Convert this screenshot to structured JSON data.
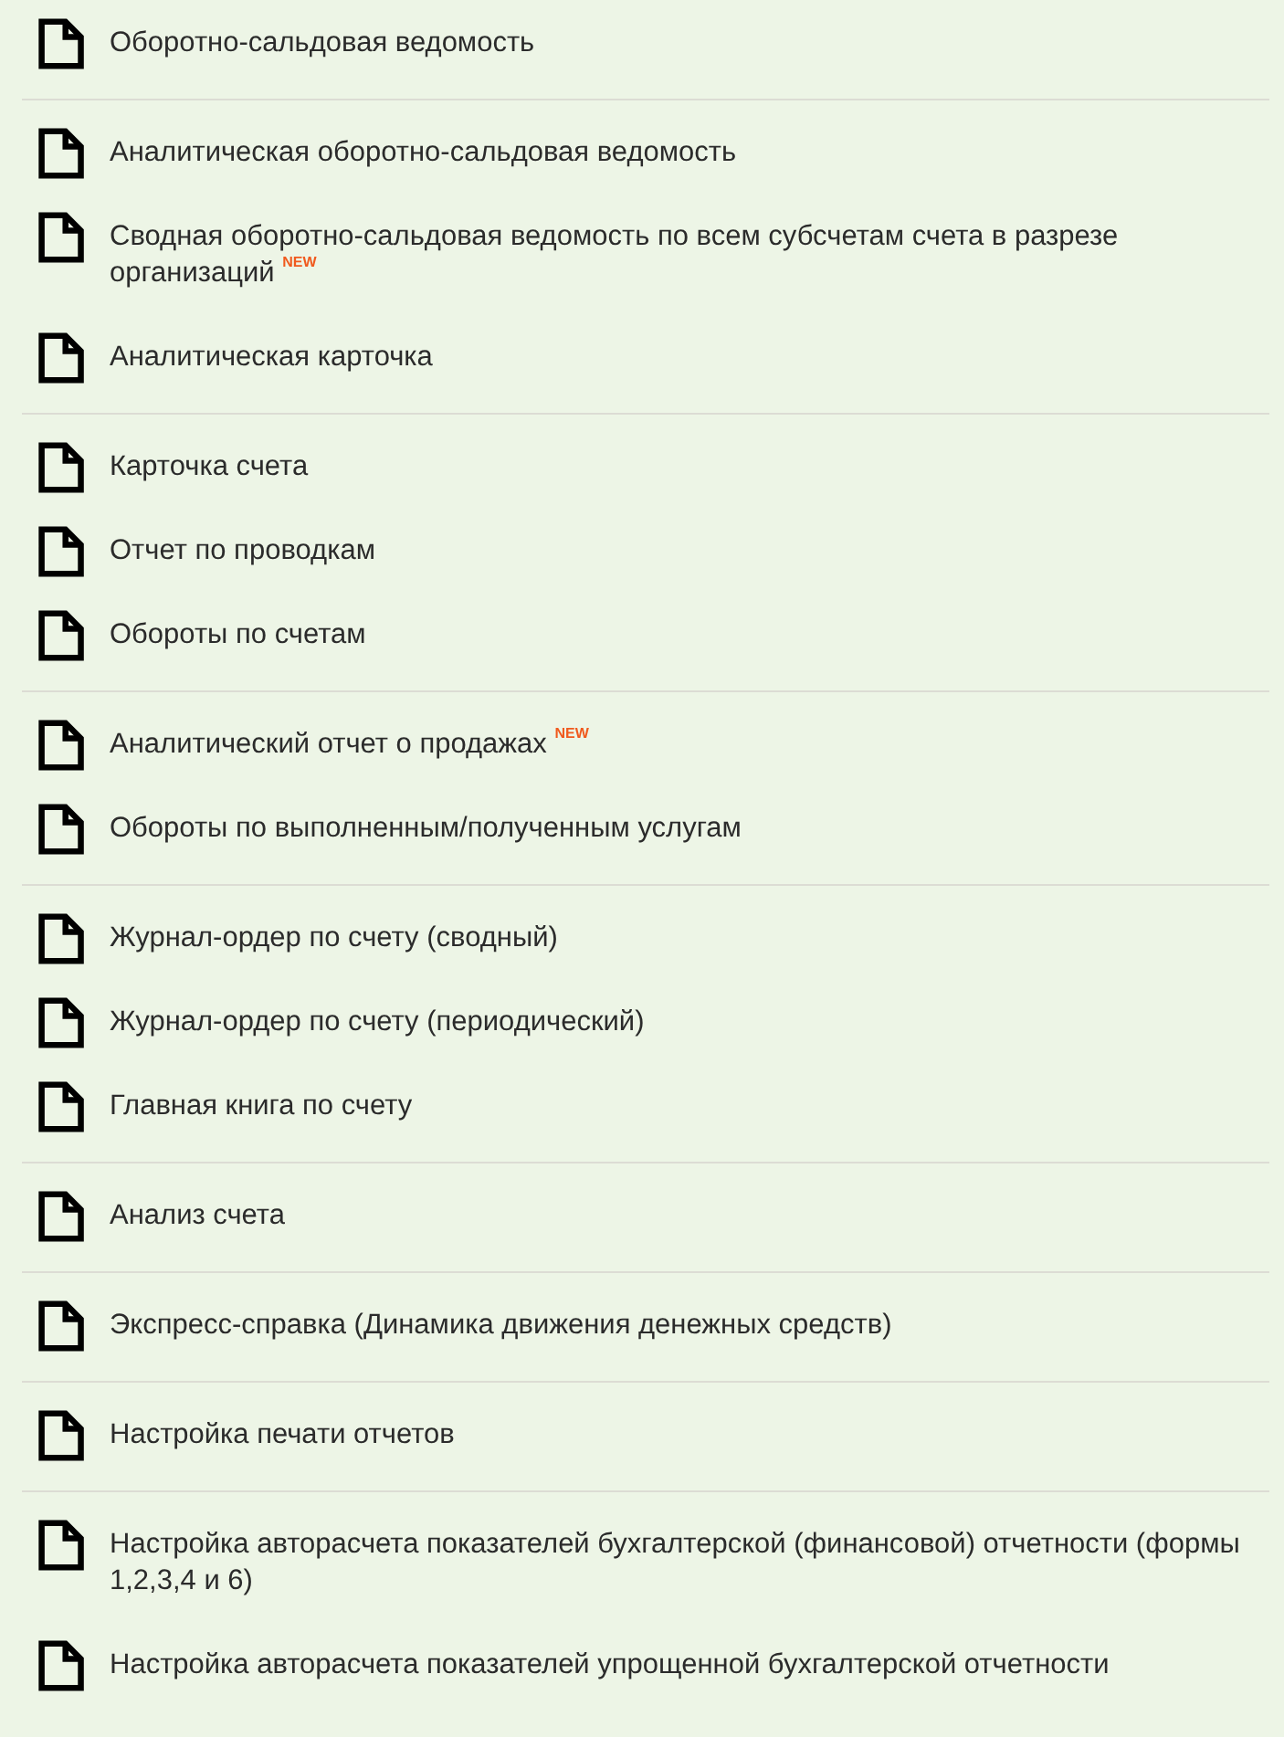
{
  "groups": [
    {
      "items": [
        {
          "label": "Оборотно-сальдовая ведомость"
        }
      ]
    },
    {
      "items": [
        {
          "label": "Аналитическая оборотно-сальдовая ведомость"
        },
        {
          "label": "Сводная оборотно-сальдовая ведомость по всем субсчетам счета в разрезе организаций $^{NEW}$"
        },
        {
          "label": "Аналитическая карточка"
        }
      ]
    },
    {
      "items": [
        {
          "label": "Карточка счета"
        },
        {
          "label": "Отчет по проводкам"
        },
        {
          "label": "Обороты по счетам"
        }
      ]
    },
    {
      "items": [
        {
          "label": "Аналитический отчет о продажах $^{NEW}$"
        },
        {
          "label": "Обороты по выполненным/полученным услугам"
        }
      ]
    },
    {
      "items": [
        {
          "label": "Журнал-ордер по счету (сводный)"
        },
        {
          "label": "Журнал-ордер по счету (периодический)"
        },
        {
          "label": "Главная книга по счету"
        }
      ]
    },
    {
      "items": [
        {
          "label": "Анализ счета"
        }
      ]
    },
    {
      "items": [
        {
          "label": "Экспресс-справка (Динамика движения денежных средств)"
        }
      ]
    },
    {
      "items": [
        {
          "label": "Настройка печати отчетов"
        }
      ]
    },
    {
      "items": [
        {
          "label": "Настройка авторасчета показателей бухгалтерской (финансовой) отчетности (формы 1,2,3,4 и 6)"
        },
        {
          "label": "Настройка авторасчета показателей упрощенной бухгалтерской отчетности"
        }
      ]
    }
  ]
}
